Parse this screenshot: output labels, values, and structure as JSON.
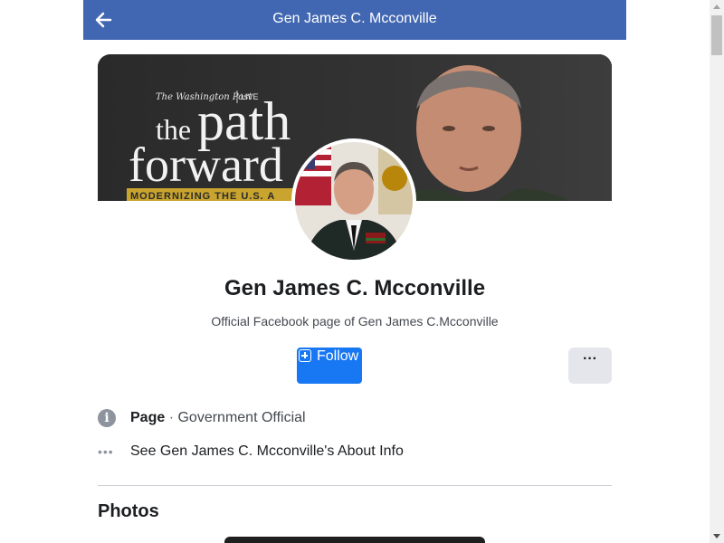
{
  "topbar": {
    "title": "Gen James C. Mcconville",
    "bg_color": "#4267b2"
  },
  "cover": {
    "publisher_prefix": "The Washington Post",
    "publisher_suffix": "LIVE",
    "headline_line1_a": "the",
    "headline_line1_b": "path",
    "headline_line2": "forward",
    "banner_text": "MODERNIZING THE U.S. A"
  },
  "profile": {
    "name": "Gen James C. Mcconville",
    "description": "Official Facebook page of Gen James C.Mcconville"
  },
  "actions": {
    "follow_label": "Follow",
    "follow_color": "#1877f2",
    "more_label": "···"
  },
  "info": {
    "type_label": "Page",
    "separator": "·",
    "category": "Government Official",
    "about_link": "See Gen James C. Mcconville's About Info",
    "info_icon_glyph": "i",
    "dots_icon_glyph": "•••"
  },
  "photos": {
    "title": "Photos"
  }
}
